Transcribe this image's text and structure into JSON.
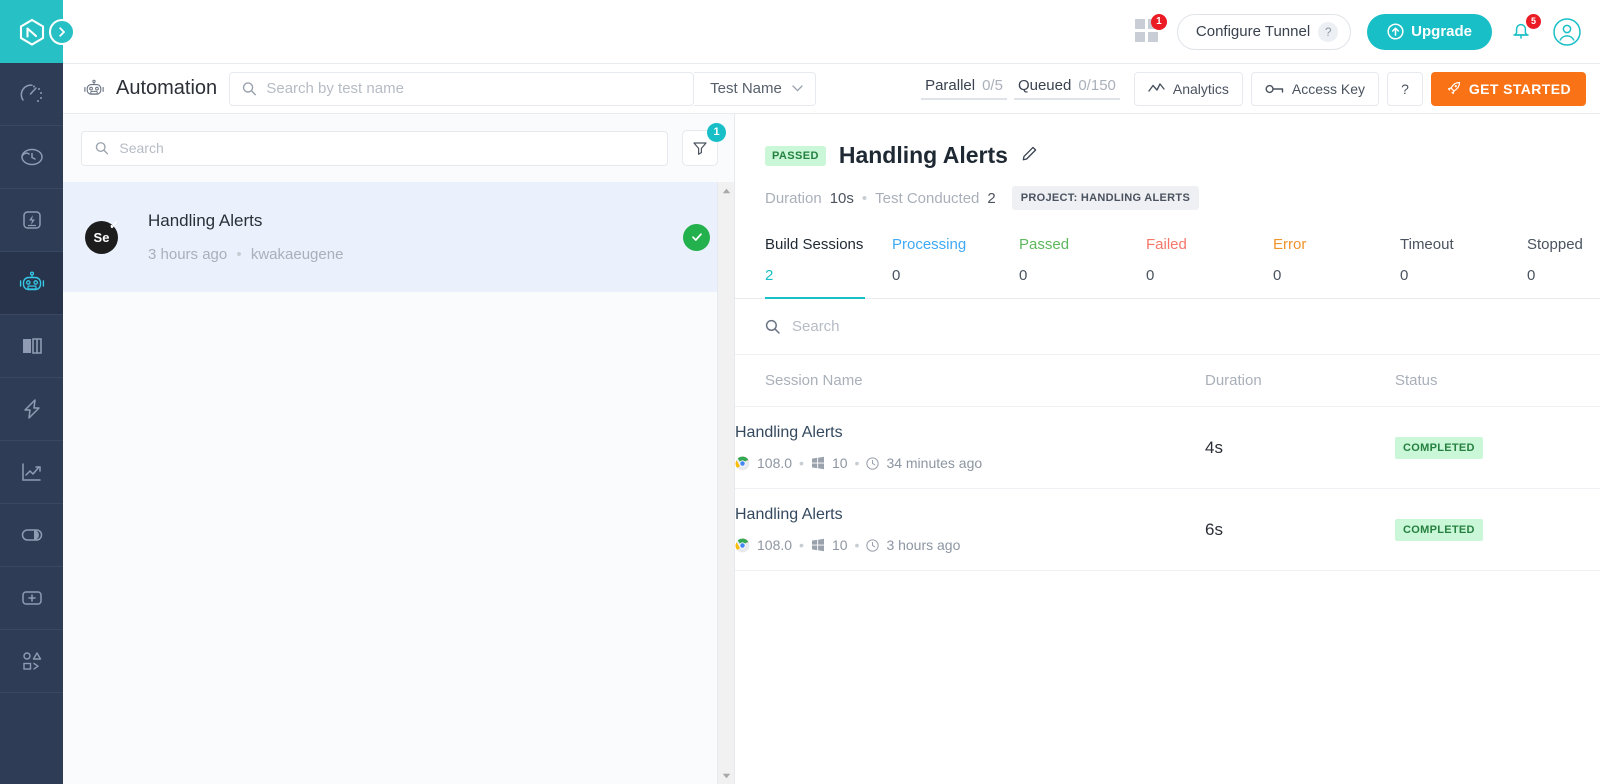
{
  "brand": {
    "accent": "#19bfc6",
    "rail_bg": "#2e3c55",
    "orange": "#f97316",
    "green": "#22b14c"
  },
  "topbar": {
    "apps_badge": "1",
    "configure_tunnel_label": "Configure Tunnel",
    "configure_tunnel_help": "?",
    "upgrade_label": "Upgrade",
    "notifications_badge": "5"
  },
  "subheader": {
    "title": "Automation",
    "search_placeholder": "Search by test name",
    "search_value": "",
    "filter_select_label": "Test Name",
    "stats": [
      {
        "label": "Parallel",
        "value": "0/5"
      },
      {
        "label": "Queued",
        "value": "0/150"
      }
    ],
    "analytics_label": "Analytics",
    "access_key_label": "Access Key",
    "help_label": "?",
    "get_started_label": "GET STARTED"
  },
  "list_panel": {
    "search_placeholder": "Search",
    "search_value": "",
    "filter_badge": "1",
    "items": [
      {
        "avatar_text": "Se",
        "name": "Handling Alerts",
        "time": "3 hours ago",
        "separator": "•",
        "user": "kwakaeugene",
        "status": "passed"
      }
    ]
  },
  "detail": {
    "status_badge": "PASSED",
    "title": "Handling Alerts",
    "meta": {
      "duration_label": "Duration",
      "duration_value": "10s",
      "separator": "•",
      "tests_label": "Test Conducted",
      "tests_value": "2",
      "project_chip": "PROJECT: HANDLING ALERTS"
    },
    "tabs": [
      {
        "label": "Build Sessions",
        "count": "2",
        "active": true,
        "color": "#1f2933"
      },
      {
        "label": "Processing",
        "count": "0",
        "active": false,
        "color": "#3fa9f5"
      },
      {
        "label": "Passed",
        "count": "0",
        "active": false,
        "color": "#5cb85c"
      },
      {
        "label": "Failed",
        "count": "0",
        "active": false,
        "color": "#f4776a"
      },
      {
        "label": "Error",
        "count": "0",
        "active": false,
        "color": "#f0932b"
      },
      {
        "label": "Timeout",
        "count": "0",
        "active": false,
        "color": "#4a535f"
      },
      {
        "label": "Stopped",
        "count": "0",
        "active": false,
        "color": "#4a535f"
      }
    ],
    "table": {
      "search_placeholder": "Search",
      "search_value": "",
      "columns": [
        "Session Name",
        "Duration",
        "Status"
      ],
      "rows": [
        {
          "name": "Handling Alerts",
          "browser": "108.0",
          "os": "10",
          "time": "34 minutes ago",
          "duration": "4s",
          "status": "COMPLETED"
        },
        {
          "name": "Handling Alerts",
          "browser": "108.0",
          "os": "10",
          "time": "3 hours ago",
          "duration": "6s",
          "status": "COMPLETED"
        }
      ]
    }
  },
  "rail": {
    "items": [
      {
        "icon": "dashboard-gauge-icon",
        "active": false
      },
      {
        "icon": "realtime-clock-icon",
        "active": false
      },
      {
        "icon": "lightning-box-icon",
        "active": false
      },
      {
        "icon": "robot-automation-icon",
        "active": true
      },
      {
        "icon": "compare-screens-icon",
        "active": false
      },
      {
        "icon": "bolt-icon",
        "active": false
      },
      {
        "icon": "analytics-chart-icon",
        "active": false
      },
      {
        "icon": "contrast-circle-icon",
        "active": false
      },
      {
        "icon": "plus-box-icon",
        "active": false
      },
      {
        "icon": "integrations-icon",
        "active": false
      }
    ]
  }
}
